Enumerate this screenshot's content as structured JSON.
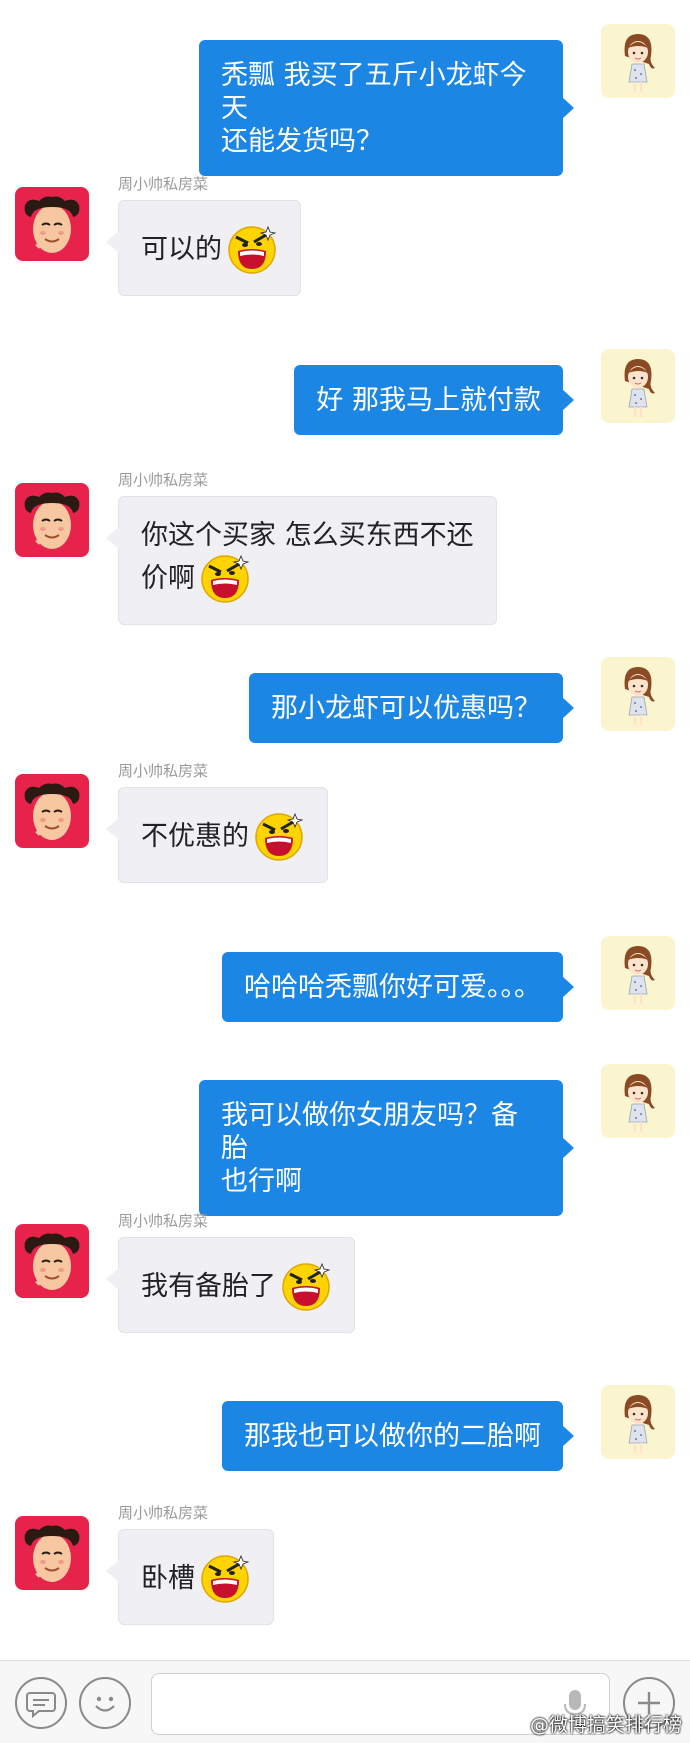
{
  "colors": {
    "outgoing": "#1b86e4",
    "incoming": "#efeff4",
    "avatar_boy": "#e8234b",
    "avatar_girl": "#fbf5cf"
  },
  "messages": [
    {
      "direction": "out",
      "lines": [
        "秃瓢 我买了五斤小龙虾今天",
        "还能发货吗？"
      ]
    },
    {
      "direction": "in",
      "sender": "周小帅私房菜",
      "lines": [
        "可以的"
      ],
      "emoji": "laughing-emoji"
    },
    {
      "direction": "out",
      "lines": [
        "好 那我马上就付款"
      ]
    },
    {
      "direction": "in",
      "sender": "周小帅私房菜",
      "lines": [
        "你这个买家 怎么买东西不还",
        "价啊"
      ],
      "emoji": "laughing-emoji"
    },
    {
      "direction": "out",
      "lines": [
        "那小龙虾可以优惠吗？"
      ]
    },
    {
      "direction": "in",
      "sender": "周小帅私房菜",
      "lines": [
        "不优惠的"
      ],
      "emoji": "laughing-emoji"
    },
    {
      "direction": "out",
      "lines": [
        "哈哈哈秃瓢你好可爱。。。"
      ]
    },
    {
      "direction": "out",
      "lines": [
        "我可以做你女朋友吗？备胎",
        "也行啊"
      ]
    },
    {
      "direction": "in",
      "sender": "周小帅私房菜",
      "lines": [
        "我有备胎了"
      ],
      "emoji": "laughing-emoji"
    },
    {
      "direction": "out",
      "lines": [
        "那我也可以做你的二胎啊"
      ]
    },
    {
      "direction": "in",
      "sender": "周小帅私房菜",
      "lines": [
        "卧槽"
      ],
      "emoji": "laughing-emoji"
    }
  ],
  "input_bar": {
    "left_icons": [
      "chat-bubble-icon",
      "smiley-icon"
    ],
    "text_value": "",
    "right_icons": [
      "microphone-icon",
      "plus-icon"
    ]
  },
  "watermark": "@微博搞笑排行榜"
}
